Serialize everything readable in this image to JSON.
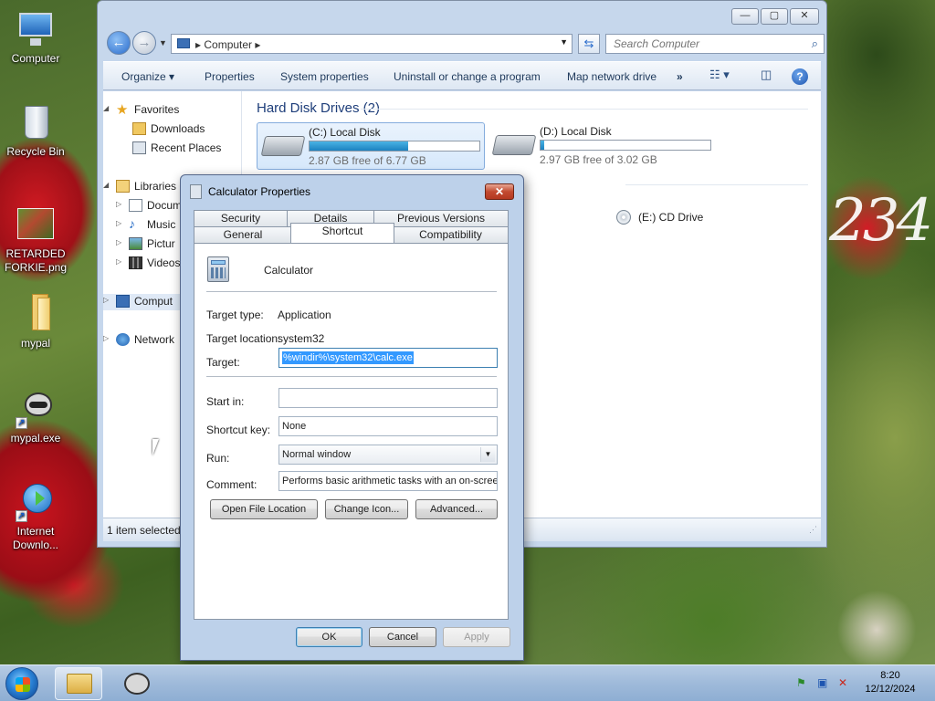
{
  "desktop": {
    "icons": [
      {
        "label": "Computer"
      },
      {
        "label": "Recycle Bin"
      },
      {
        "label": "RETARDED FORKIE.png"
      },
      {
        "label": "mypal"
      },
      {
        "label": "mypal.exe"
      },
      {
        "label": "Internet Downlo..."
      }
    ],
    "wallpaper_text": "234"
  },
  "explorer": {
    "address": {
      "crumb": "Computer"
    },
    "search": {
      "placeholder": "Search Computer"
    },
    "toolbar": {
      "organize": "Organize",
      "properties": "Properties",
      "system_properties": "System properties",
      "uninstall": "Uninstall or change a program",
      "map_drive": "Map network drive",
      "more": "»"
    },
    "nav": {
      "favorites": "Favorites",
      "downloads": "Downloads",
      "recent": "Recent Places",
      "libraries": "Libraries",
      "documents": "Docum",
      "music": "Music",
      "pictures": "Pictur",
      "videos": "Videos",
      "computer": "Comput",
      "network": "Network"
    },
    "groups": {
      "hdd_title": "Hard Disk Drives (2)"
    },
    "drives": [
      {
        "name": "(C:) Local Disk",
        "free": "2.87 GB free of 6.77 GB",
        "used_fraction": 0.58
      },
      {
        "name": "(D:) Local Disk",
        "free": "2.97 GB free of 3.02 GB",
        "used_fraction": 0.02
      },
      {
        "name": "(E:) CD Drive"
      }
    ],
    "status": "1 item selected"
  },
  "dialog": {
    "title": "Calculator Properties",
    "tabs_row1": [
      "Security",
      "Details",
      "Previous Versions"
    ],
    "tabs_row2": [
      "General",
      "Shortcut",
      "Compatibility"
    ],
    "name": "Calculator",
    "fields": {
      "target_type_label": "Target type:",
      "target_type": "Application",
      "target_location_label": "Target location:",
      "target_location": "system32",
      "target_label": "Target:",
      "target": "%windir%\\system32\\calc.exe",
      "start_in_label": "Start in:",
      "start_in": "",
      "shortcut_key_label": "Shortcut key:",
      "shortcut_key": "None",
      "run_label": "Run:",
      "run": "Normal window",
      "comment_label": "Comment:",
      "comment": "Performs basic arithmetic tasks with an on-screen"
    },
    "buttons": {
      "open_location": "Open File Location",
      "change_icon": "Change Icon...",
      "advanced": "Advanced...",
      "ok": "OK",
      "cancel": "Cancel",
      "apply": "Apply"
    }
  },
  "taskbar": {
    "time": "8:20",
    "date": "12/12/2024"
  }
}
